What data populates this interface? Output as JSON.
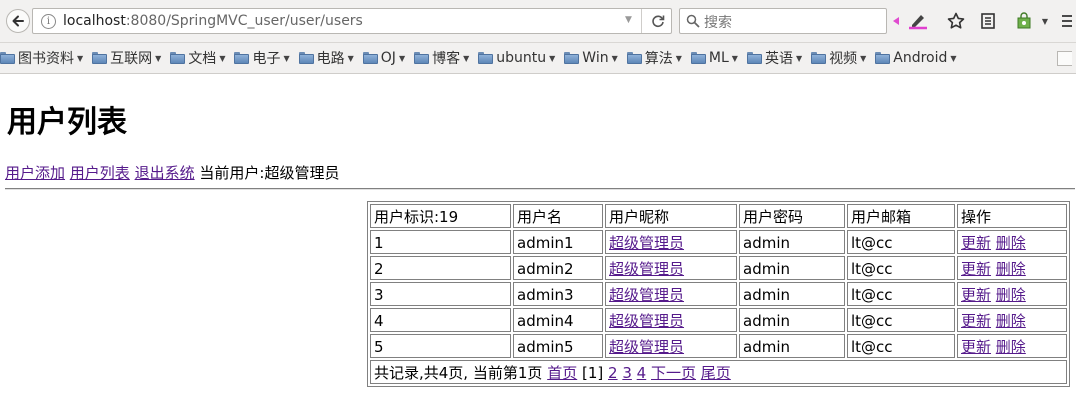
{
  "browser": {
    "url_host": "localhost",
    "url_rest": ":8080/SpringMVC_user/user/users",
    "search_placeholder": "搜索"
  },
  "bookmarks": [
    {
      "label": "图书资料"
    },
    {
      "label": "互联网"
    },
    {
      "label": "文档"
    },
    {
      "label": "电子"
    },
    {
      "label": "电路"
    },
    {
      "label": "OJ"
    },
    {
      "label": "博客"
    },
    {
      "label": "ubuntu"
    },
    {
      "label": "Win"
    },
    {
      "label": "算法"
    },
    {
      "label": "ML"
    },
    {
      "label": "英语"
    },
    {
      "label": "视频"
    },
    {
      "label": "Android"
    }
  ],
  "page": {
    "title": "用户列表",
    "nav": {
      "add_link": "用户添加",
      "list_link": "用户列表",
      "logout_link": "退出系统",
      "current_user": "当前用户:超级管理员"
    }
  },
  "table": {
    "headers": [
      "用户标识:19",
      "用户名",
      "用户昵称",
      "用户密码",
      "用户邮箱",
      "操作"
    ],
    "rows": [
      {
        "id": "1",
        "username": "admin1",
        "nickname": "超级管理员",
        "password": "admin",
        "email": "lt@cc",
        "update": "更新",
        "delete": "删除"
      },
      {
        "id": "2",
        "username": "admin2",
        "nickname": "超级管理员",
        "password": "admin",
        "email": "lt@cc",
        "update": "更新",
        "delete": "删除"
      },
      {
        "id": "3",
        "username": "admin3",
        "nickname": "超级管理员",
        "password": "admin",
        "email": "lt@cc",
        "update": "更新",
        "delete": "删除"
      },
      {
        "id": "4",
        "username": "admin4",
        "nickname": "超级管理员",
        "password": "admin",
        "email": "lt@cc",
        "update": "更新",
        "delete": "删除"
      },
      {
        "id": "5",
        "username": "admin5",
        "nickname": "超级管理员",
        "password": "admin",
        "email": "lt@cc",
        "update": "更新",
        "delete": "删除"
      }
    ],
    "pager": {
      "summary": "共记录,共4页, 当前第1页",
      "first": "首页",
      "current": "[1]",
      "pages": [
        "2",
        "3",
        "4"
      ],
      "next": "下一页",
      "last": "尾页"
    }
  },
  "colors": {
    "visited_link": "#551a8b",
    "link": "#0000ee",
    "chrome_bg": "#f2f1f0"
  },
  "icons": {
    "back": "back-arrow-icon",
    "info": "info-icon",
    "reload": "reload-icon",
    "search": "search-icon",
    "highlighter": "highlighter-icon",
    "star": "star-icon",
    "reading_list": "reading-list-icon",
    "extension": "extension-icon",
    "bookmark_folder": "folder-icon"
  }
}
